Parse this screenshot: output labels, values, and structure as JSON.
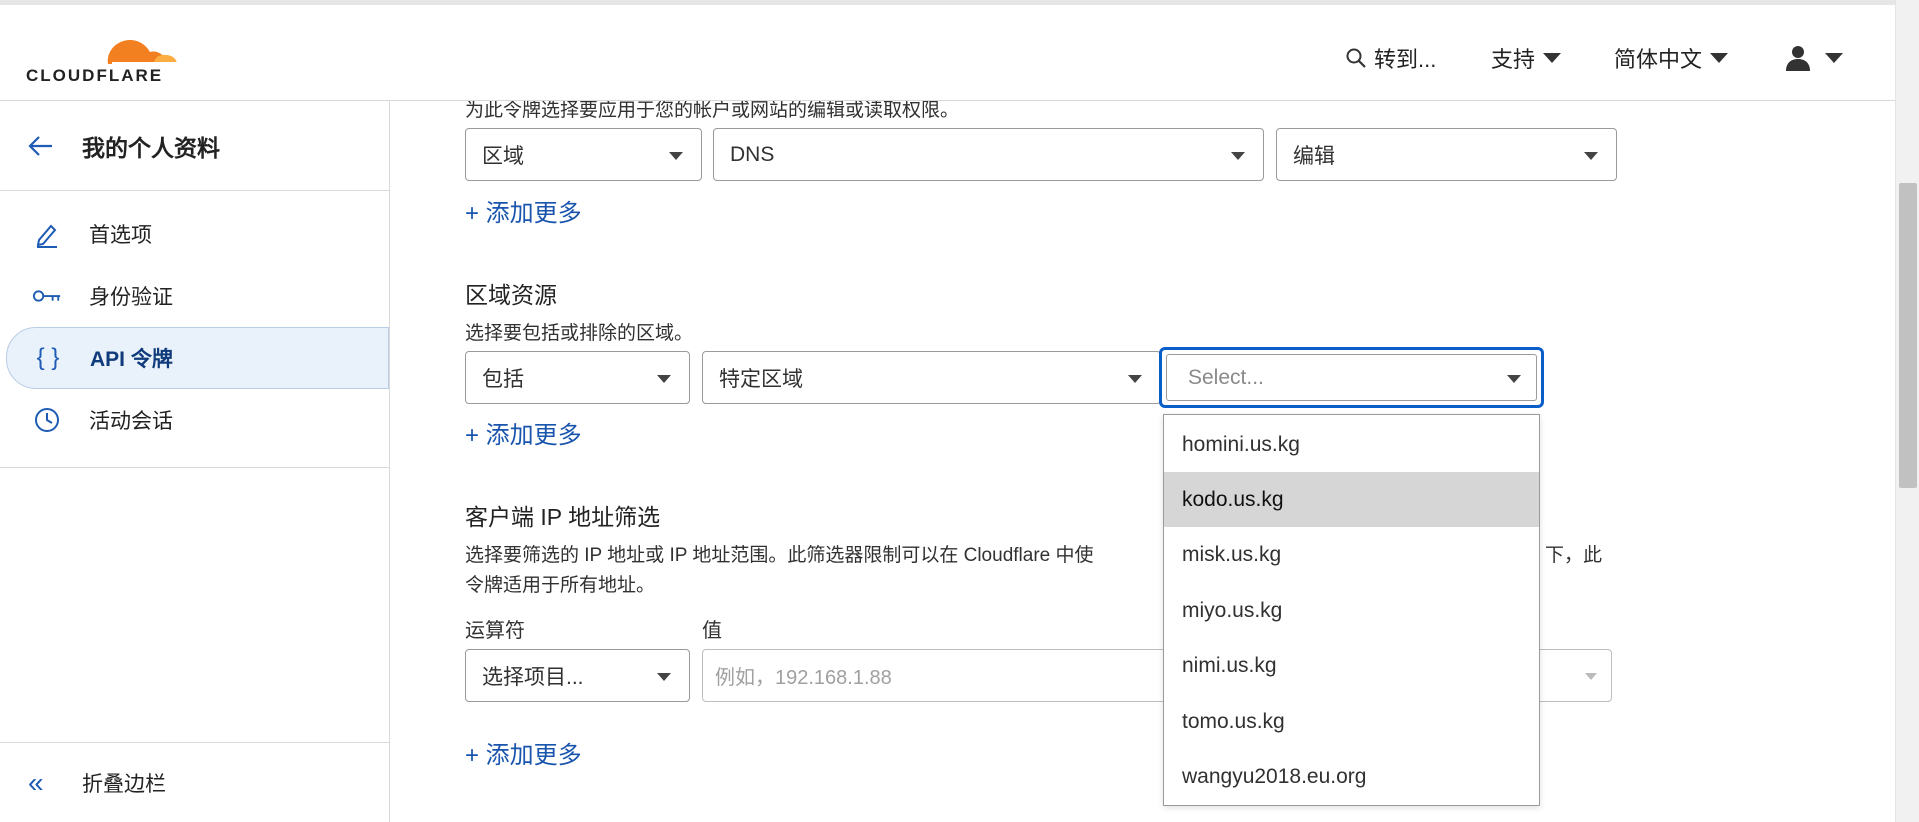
{
  "header": {
    "logo_text": "CLOUDFLARE",
    "search_label": "转到...",
    "support_label": "支持",
    "language_label": "简体中文"
  },
  "sidebar": {
    "title": "我的个人资料",
    "items": [
      {
        "label": "首选项"
      },
      {
        "label": "身份验证"
      },
      {
        "label": "API 令牌",
        "icon_text": "{ }"
      },
      {
        "label": "活动会话"
      }
    ],
    "collapse_label": "折叠边栏"
  },
  "permissions": {
    "description": "为此令牌选择要应用于您的帐户或网站的编辑或读取权限。",
    "scope_value": "区域",
    "resource_value": "DNS",
    "permission_value": "编辑",
    "add_more": "+ 添加更多"
  },
  "zone_resources": {
    "heading": "区域资源",
    "description": "选择要包括或排除的区域。",
    "include_value": "包括",
    "type_value": "特定区域",
    "zone_placeholder": "Select...",
    "add_more": "+ 添加更多",
    "options": [
      "homini.us.kg",
      "kodo.us.kg",
      "misk.us.kg",
      "miyo.us.kg",
      "nimi.us.kg",
      "tomo.us.kg",
      "wangyu2018.eu.org"
    ],
    "highlighted_option": "kodo.us.kg"
  },
  "ip_filter": {
    "heading": "客户端 IP 地址筛选",
    "description_line1_start": "选择要筛选的 IP 地址或 IP 地址范围。此筛选器限制可以在 Cloudflare 中使",
    "description_line1_end": "下，此",
    "description_line2": "令牌适用于所有地址。",
    "operator_label": "运算符",
    "value_label": "值",
    "operator_placeholder": "选择项目...",
    "value_placeholder": "例如，192.168.1.88",
    "add_more": "+ 添加更多"
  },
  "colors": {
    "accent": "#1a55ad",
    "focus_border": "#0a5ec9",
    "active_sidebar_bg": "#e9f1fb",
    "logo_orange": "#f38020"
  }
}
